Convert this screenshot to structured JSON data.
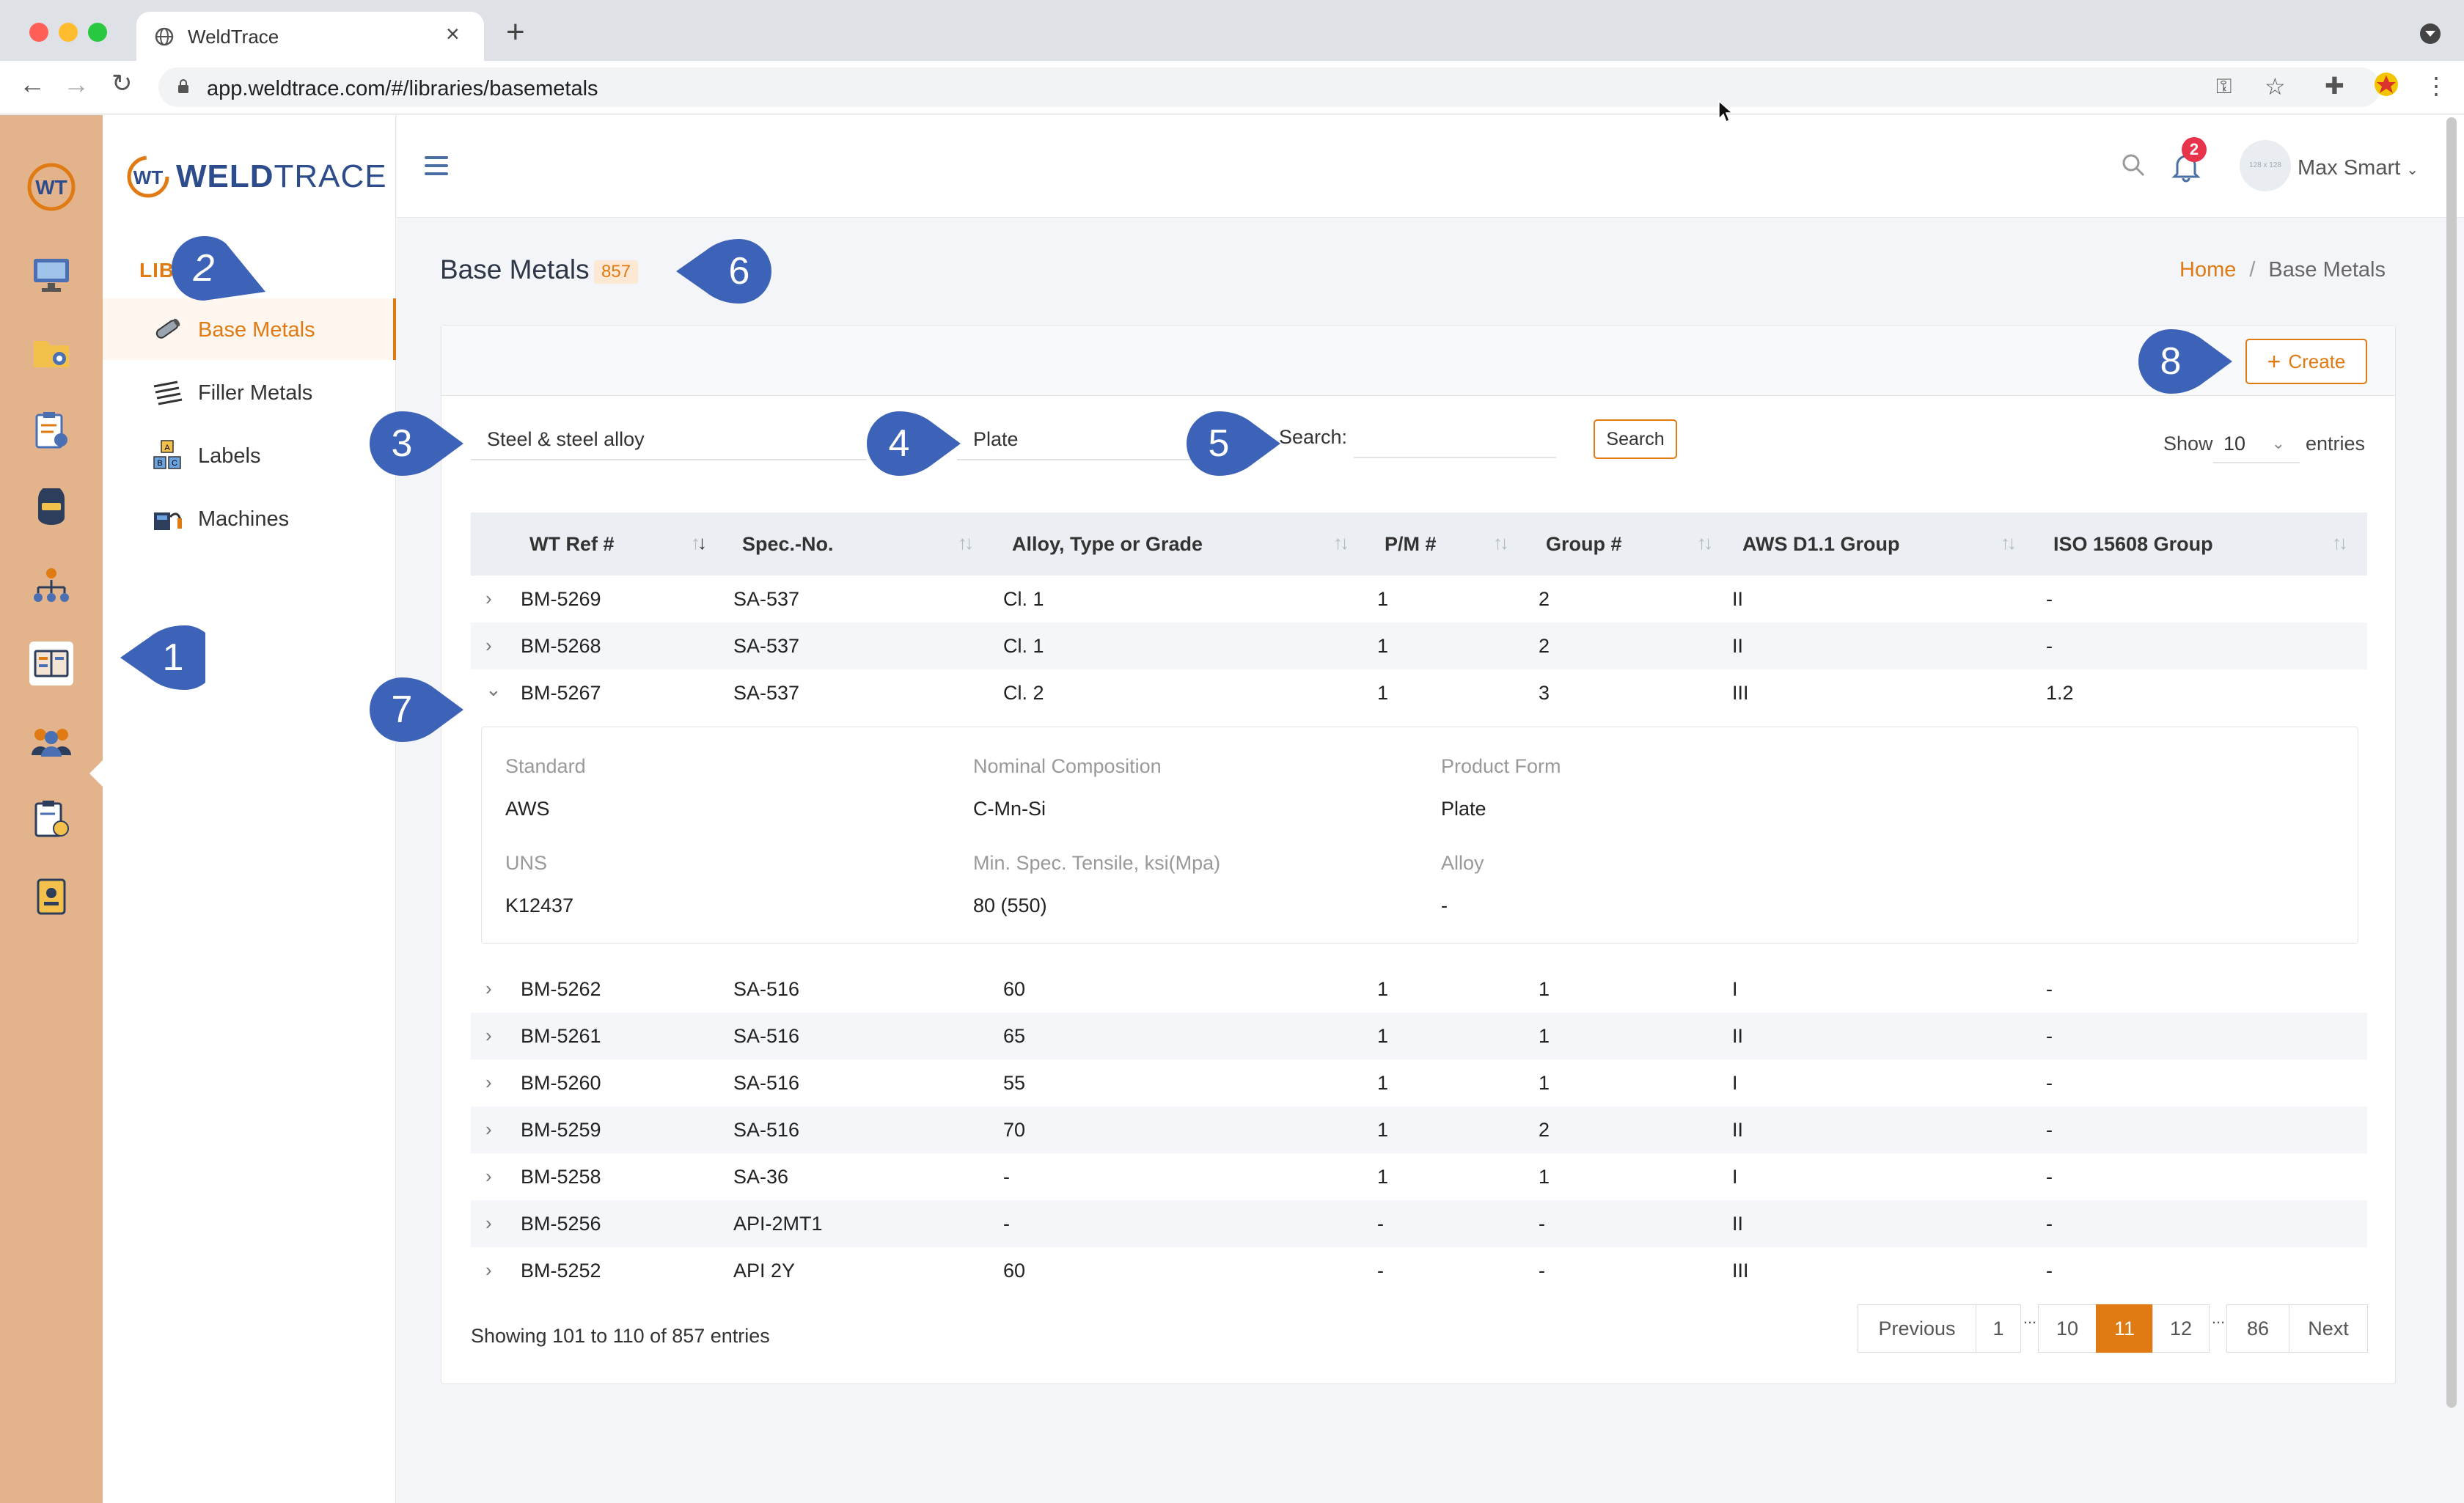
{
  "browser": {
    "tab_title": "WeldTrace",
    "url": "app.weldtrace.com/#/libraries/basemetals",
    "colors": {
      "close": "#ff5f57",
      "minimize": "#febc2e",
      "maximize": "#28c840"
    }
  },
  "app": {
    "brand": {
      "prefix": "WT",
      "name_a": "WELD",
      "name_b": "TRACE"
    },
    "rail_items": [
      "desktop-icon",
      "folder-settings-icon",
      "clipboard-gear-icon",
      "welder-mask-icon",
      "org-chart-icon",
      "library-books-icon",
      "team-icon",
      "clipboard-clock-icon",
      "id-badge-icon"
    ],
    "sidebar": {
      "section_title": "LIBR",
      "items": [
        {
          "label": "Base Metals",
          "icon": "pipe-icon",
          "active": true
        },
        {
          "label": "Filler Metals",
          "icon": "rods-icon",
          "active": false
        },
        {
          "label": "Labels",
          "icon": "abc-blocks-icon",
          "active": false
        },
        {
          "label": "Machines",
          "icon": "welding-machine-icon",
          "active": false
        }
      ]
    },
    "header": {
      "user_name": "Max Smart",
      "avatar_text": "128 x 128",
      "notification_count": "2"
    },
    "accent": "#e07a12"
  },
  "page": {
    "title": "Base Metals",
    "count": "857",
    "breadcrumb": {
      "home": "Home",
      "separator": "/",
      "current": "Base Metals"
    },
    "create_label": "Create",
    "filters": {
      "material": "Steel & steel alloy",
      "form": "Plate",
      "search_label": "Search:",
      "search_value": "",
      "search_button": "Search",
      "show_label": "Show",
      "show_value": "10",
      "entries_label": "entries"
    },
    "table": {
      "columns": [
        "WT Ref #",
        "Spec.-No.",
        "Alloy, Type or Grade",
        "P/M #",
        "Group #",
        "AWS D1.1 Group",
        "ISO 15608 Group"
      ],
      "rows_top": [
        {
          "ref": "BM-5269",
          "spec": "SA-537",
          "grade": "Cl. 1",
          "pm": "1",
          "group": "2",
          "aws": "II",
          "iso": "-"
        },
        {
          "ref": "BM-5268",
          "spec": "SA-537",
          "grade": "Cl. 1",
          "pm": "1",
          "group": "2",
          "aws": "II",
          "iso": "-"
        },
        {
          "ref": "BM-5267",
          "spec": "SA-537",
          "grade": "Cl. 2",
          "pm": "1",
          "group": "3",
          "aws": "III",
          "iso": "1.2"
        }
      ],
      "detail": {
        "standard_label": "Standard",
        "standard": "AWS",
        "composition_label": "Nominal Composition",
        "composition": "C-Mn-Si",
        "form_label": "Product Form",
        "form": "Plate",
        "uns_label": "UNS",
        "uns": "K12437",
        "tensile_label": "Min. Spec. Tensile, ksi(Mpa)",
        "tensile": "80 (550)",
        "alloy_label": "Alloy",
        "alloy": "-"
      },
      "rows_bottom": [
        {
          "ref": "BM-5262",
          "spec": "SA-516",
          "grade": "60",
          "pm": "1",
          "group": "1",
          "aws": "I",
          "iso": "-"
        },
        {
          "ref": "BM-5261",
          "spec": "SA-516",
          "grade": "65",
          "pm": "1",
          "group": "1",
          "aws": "II",
          "iso": "-"
        },
        {
          "ref": "BM-5260",
          "spec": "SA-516",
          "grade": "55",
          "pm": "1",
          "group": "1",
          "aws": "I",
          "iso": "-"
        },
        {
          "ref": "BM-5259",
          "spec": "SA-516",
          "grade": "70",
          "pm": "1",
          "group": "2",
          "aws": "II",
          "iso": "-"
        },
        {
          "ref": "BM-5258",
          "spec": "SA-36",
          "grade": "-",
          "pm": "1",
          "group": "1",
          "aws": "I",
          "iso": "-"
        },
        {
          "ref": "BM-5256",
          "spec": "API-2MT1",
          "grade": "-",
          "pm": "-",
          "group": "-",
          "aws": "II",
          "iso": "-"
        },
        {
          "ref": "BM-5252",
          "spec": "API 2Y",
          "grade": "60",
          "pm": "-",
          "group": "-",
          "aws": "III",
          "iso": "-"
        }
      ]
    },
    "showing": "Showing 101 to 110 of 857 entries",
    "pagination": {
      "previous": "Previous",
      "next": "Next",
      "pages": [
        "1",
        "10",
        "11",
        "12",
        "86"
      ],
      "current": "11",
      "ellipsis": "..."
    }
  },
  "annotations": {
    "colors": {
      "fill": "#3d63b8"
    },
    "labels": [
      "1",
      "2",
      "3",
      "4",
      "5",
      "6",
      "7",
      "8"
    ]
  }
}
